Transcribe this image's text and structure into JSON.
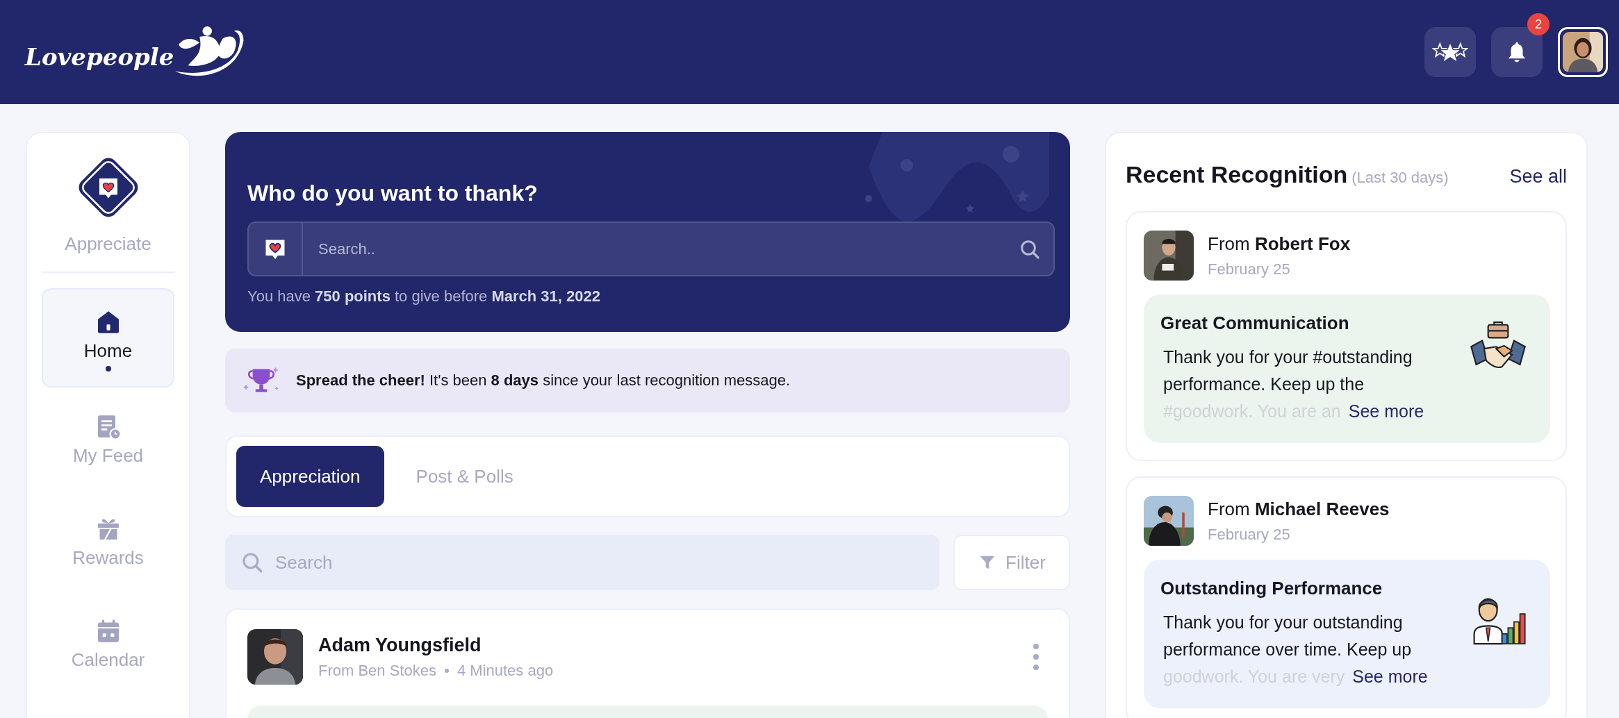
{
  "header": {
    "logo": "Lovepeople",
    "notifications": "2"
  },
  "sidebar": {
    "appreciate": "Appreciate",
    "items": [
      {
        "label": "Home",
        "selected": true
      },
      {
        "label": "My Feed",
        "selected": false
      },
      {
        "label": "Rewards",
        "selected": false
      },
      {
        "label": "Calendar",
        "selected": false
      }
    ]
  },
  "hero": {
    "title": "Who do you want to thank?",
    "search": {
      "placeholder": "Search.."
    },
    "points": "You have **750 points** to give before **March 31, 2022**"
  },
  "banner": {
    "message": "**Spread the cheer!** It's been **8 days** since your last recognition message."
  },
  "tabs": [
    {
      "label": "Appreciation",
      "selected": true
    },
    {
      "label": "Post & Polls",
      "selected": false
    }
  ],
  "feed_search": {
    "placeholder": "Search"
  },
  "filter": "Filter",
  "post": {
    "name": "Adam Youngsfield",
    "from": "From Ben Stokes",
    "time": "4 Minutes ago"
  },
  "recognition": {
    "title": "Recent Recognition",
    "period": "(Last 30 days)",
    "see_all": "See all",
    "items": [
      {
        "from": "From **Robert Fox**",
        "date": "February 25",
        "badge": "Great Communication",
        "message": "Thank you for your #outstanding performance. Keep up the",
        "faded": "#goodwork. You are an",
        "see_more": "See more",
        "color": "#ecf4ee",
        "kind": "handshake"
      },
      {
        "from": "From **Michael Reeves**",
        "date": "February 25",
        "badge": "Outstanding Performance",
        "message": "Thank you for your outstanding performance over time. Keep up",
        "faded": "goodwork. You are very",
        "see_more": "See more",
        "color": "#edf1fc",
        "kind": "growth"
      }
    ]
  }
}
